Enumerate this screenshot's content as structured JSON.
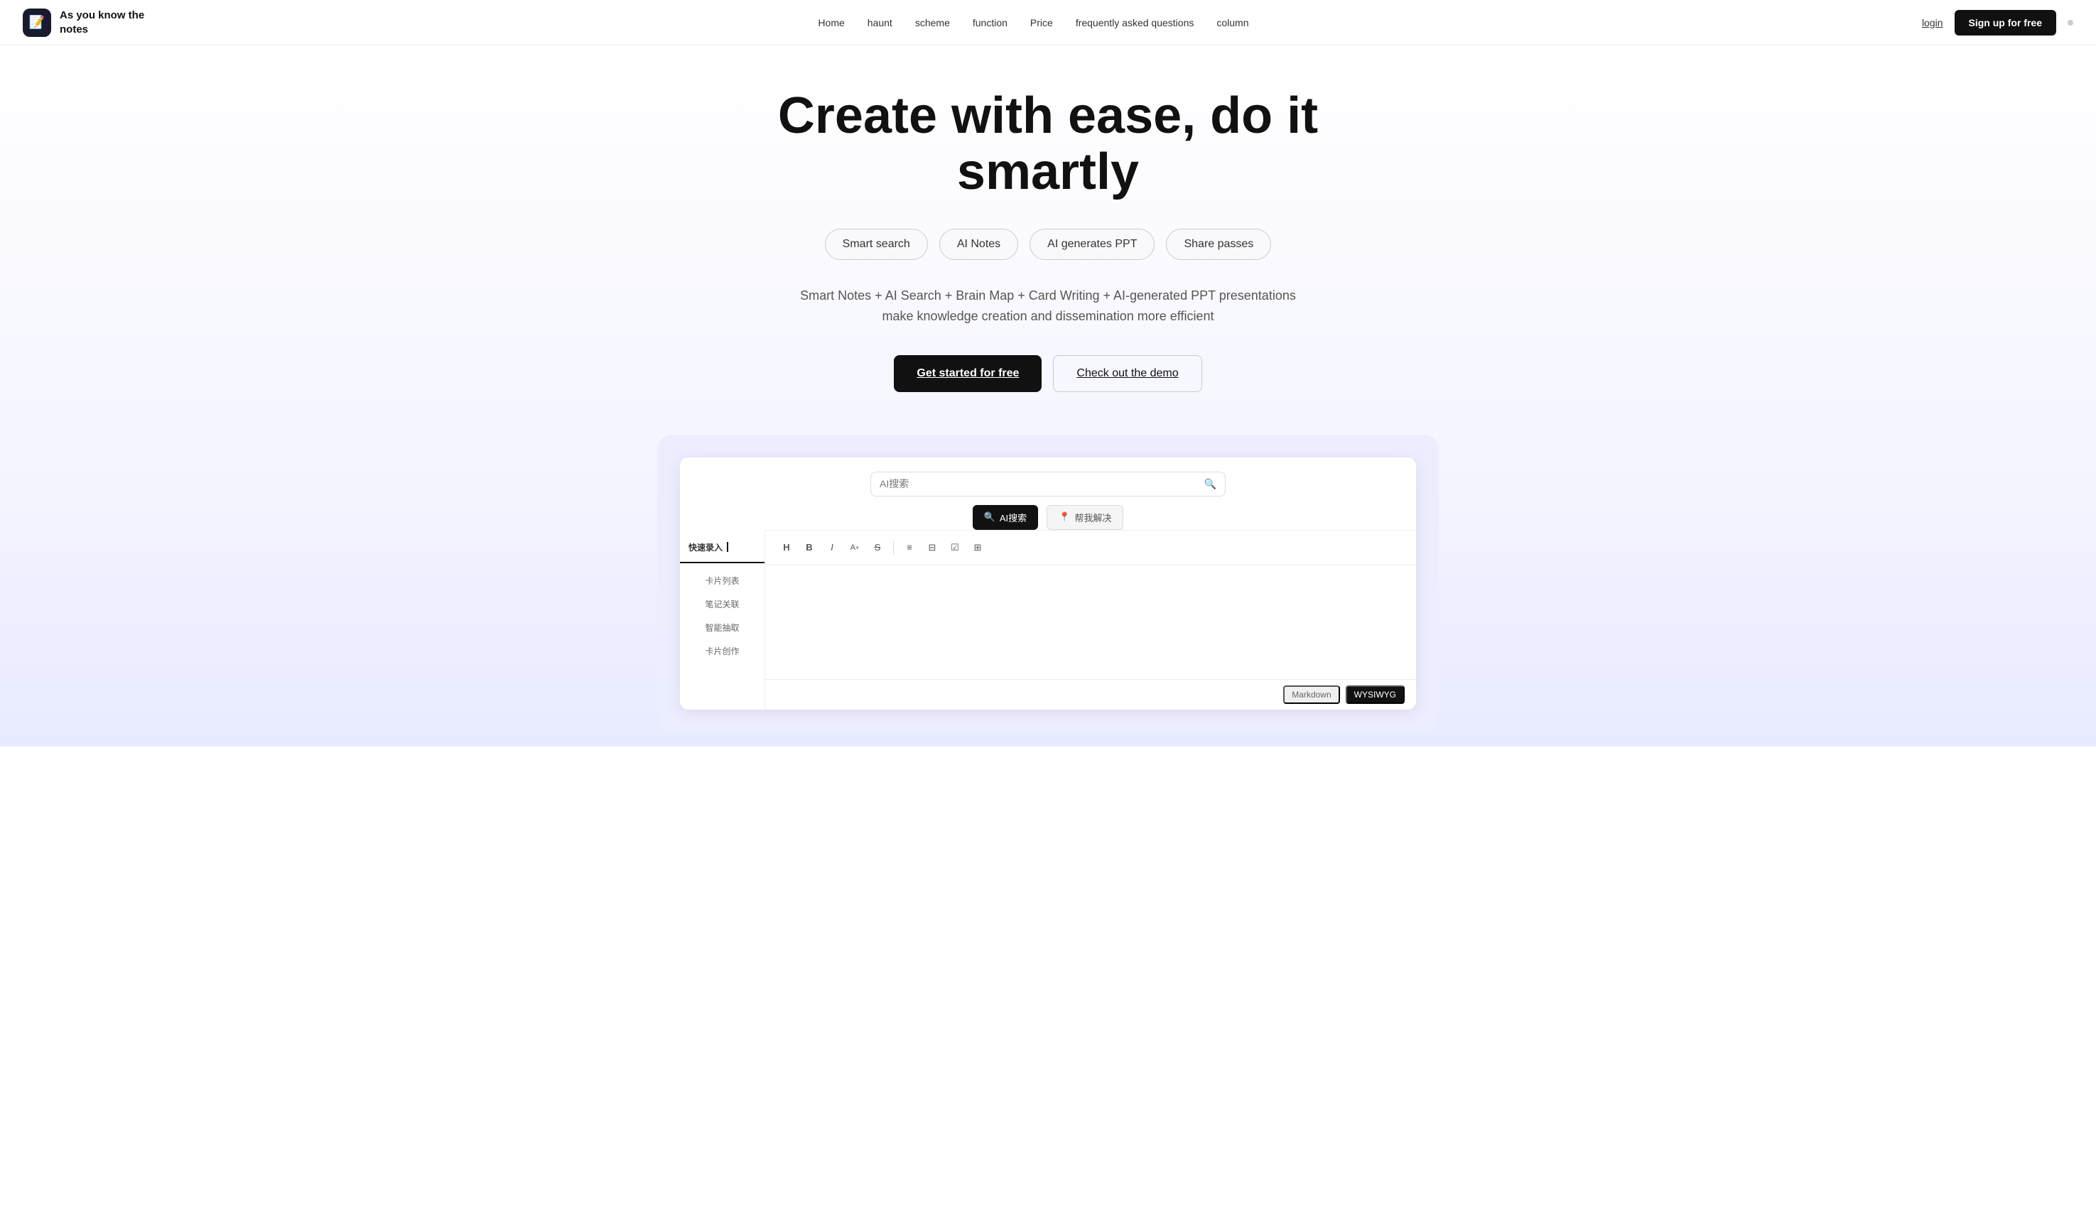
{
  "nav": {
    "logo_icon": "📝",
    "logo_text": "As you know the notes",
    "links": [
      {
        "label": "Home",
        "id": "home"
      },
      {
        "label": "haunt",
        "id": "haunt"
      },
      {
        "label": "scheme",
        "id": "scheme"
      },
      {
        "label": "function",
        "id": "function"
      },
      {
        "label": "Price",
        "id": "price"
      },
      {
        "label": "frequently asked questions",
        "id": "faq"
      },
      {
        "label": "column",
        "id": "column"
      }
    ],
    "login_label": "login",
    "signup_label": "Sign up for free"
  },
  "hero": {
    "heading_line1": "Create with ease, do it",
    "heading_line2": "smartly",
    "pills": [
      {
        "label": "Smart search",
        "id": "smart-search"
      },
      {
        "label": "AI Notes",
        "id": "ai-notes"
      },
      {
        "label": "AI generates PPT",
        "id": "ai-ppt"
      },
      {
        "label": "Share passes",
        "id": "share-passes"
      }
    ],
    "subtitle": "Smart Notes + AI Search + Brain Map + Card Writing + AI-generated PPT presentations make knowledge creation and dissemination more efficient",
    "cta_primary": "Get started for free",
    "cta_secondary": "Check out the demo"
  },
  "demo": {
    "search_placeholder": "AI搜索",
    "ai_search_label": "AI搜索",
    "ai_help_label": "帮我解决",
    "sidebar_header": "快速录入",
    "sidebar_items": [
      {
        "label": "卡片列表"
      },
      {
        "label": "笔记关联"
      },
      {
        "label": "智能抽取"
      },
      {
        "label": "卡片创作"
      }
    ],
    "toolbar_buttons": [
      {
        "icon": "H",
        "name": "heading"
      },
      {
        "icon": "B",
        "name": "bold"
      },
      {
        "icon": "I",
        "name": "italic"
      },
      {
        "icon": "A+",
        "name": "font-size"
      },
      {
        "icon": "S",
        "name": "strikethrough"
      },
      {
        "icon": "≡",
        "name": "list"
      },
      {
        "icon": "⊟",
        "name": "ordered-list"
      },
      {
        "icon": "☑",
        "name": "checklist"
      },
      {
        "icon": "⊞",
        "name": "table"
      }
    ],
    "editor_placeholder": "",
    "footer_mode1": "Markdown",
    "footer_mode2": "WYSIWYG"
  }
}
